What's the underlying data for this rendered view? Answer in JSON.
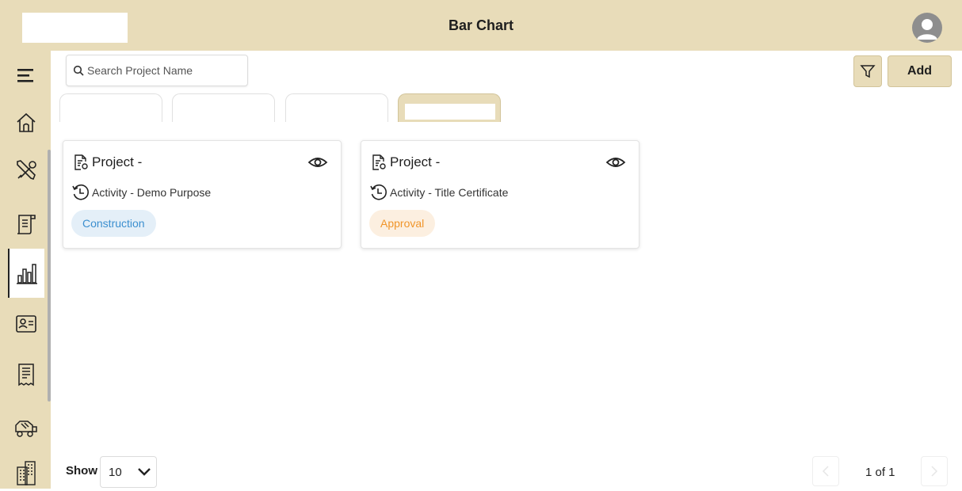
{
  "header": {
    "title": "Bar Chart"
  },
  "search": {
    "placeholder": "Search Project Name"
  },
  "toolbar": {
    "add_label": "Add"
  },
  "tabs": [
    {
      "label": ""
    },
    {
      "label": ""
    },
    {
      "label": ""
    },
    {
      "label": ""
    }
  ],
  "cards": [
    {
      "project_label": "Project -",
      "activity": "Activity - Demo Purpose",
      "badge": "Construction",
      "badge_color": "#3b8fcf"
    },
    {
      "project_label": "Project -",
      "activity": "Activity - Title Certificate",
      "badge": "Approval",
      "badge_color": "#f0952a"
    }
  ],
  "sidebar": {
    "items": [
      {
        "icon": "menu-icon"
      },
      {
        "icon": "home-icon"
      },
      {
        "icon": "tools-icon"
      },
      {
        "icon": "document-icon"
      },
      {
        "icon": "bar-chart-icon",
        "active": true
      },
      {
        "icon": "id-card-icon"
      },
      {
        "icon": "receipt-icon"
      },
      {
        "icon": "concrete-mixer-icon"
      },
      {
        "icon": "building-icon"
      }
    ]
  },
  "pagination": {
    "show_label": "Show",
    "page_size": "10",
    "page_info": "1 of 1"
  },
  "colors": {
    "accent": "#e8dcb9"
  }
}
